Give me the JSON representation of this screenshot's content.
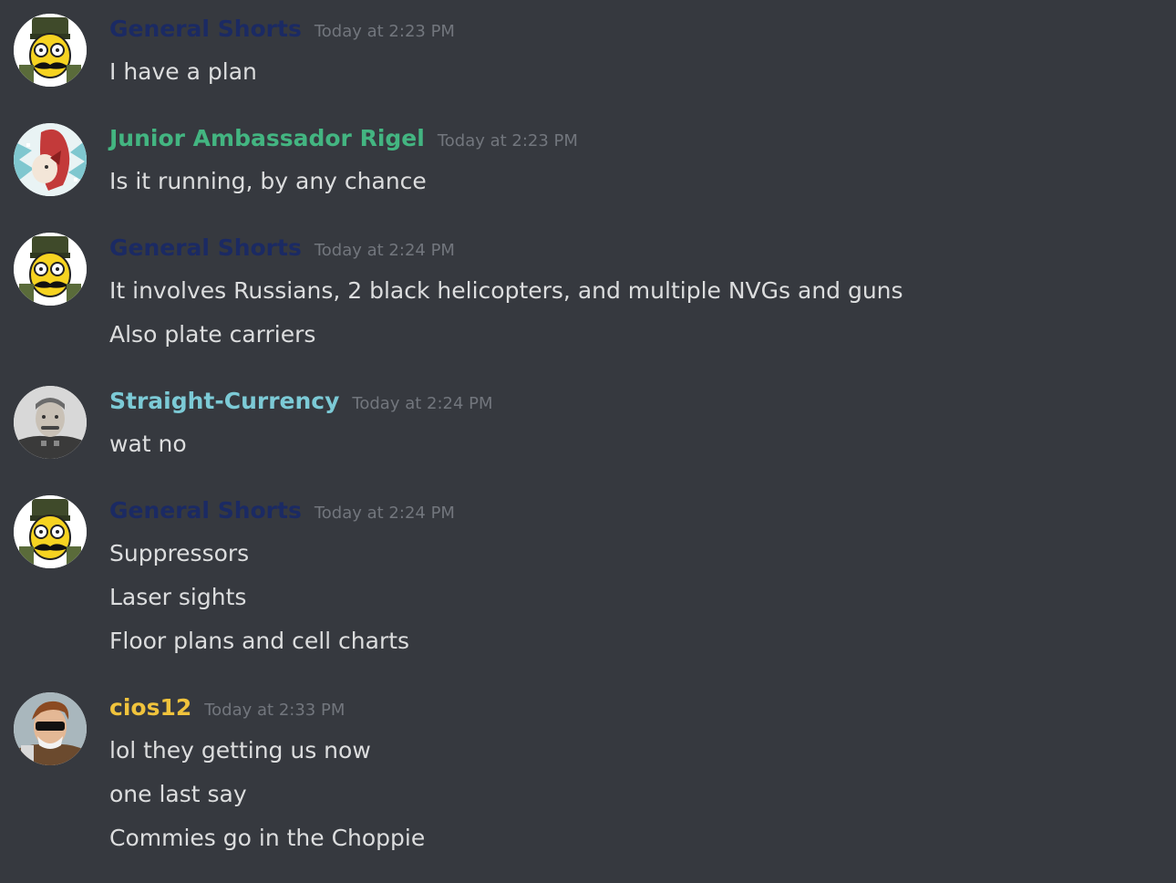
{
  "colors": {
    "background": "#36393f",
    "text": "#dcddde",
    "timestamp": "#72767d"
  },
  "messages": [
    {
      "author": "General Shorts",
      "author_color": "#1b2a63",
      "avatar_icon": "cartoon-general-avatar-icon",
      "timestamp": "Today at 2:23 PM",
      "lines": [
        "I have a plan"
      ]
    },
    {
      "author": "Junior Ambassador Rigel",
      "author_color": "#43b581",
      "avatar_icon": "anime-character-avatar-icon",
      "timestamp": "Today at 2:23 PM",
      "lines": [
        "Is it running, by any chance"
      ]
    },
    {
      "author": "General Shorts",
      "author_color": "#1b2a63",
      "avatar_icon": "cartoon-general-avatar-icon",
      "timestamp": "Today at 2:24 PM",
      "lines": [
        "It involves Russians, 2 black helicopters, and multiple NVGs and guns",
        "Also plate carriers"
      ]
    },
    {
      "author": "Straight-Currency",
      "author_color": "#7ccad6",
      "avatar_icon": "portrait-photo-avatar-icon",
      "timestamp": "Today at 2:24 PM",
      "lines": [
        "wat no"
      ]
    },
    {
      "author": "General Shorts",
      "author_color": "#1b2a63",
      "avatar_icon": "cartoon-general-avatar-icon",
      "timestamp": "Today at 2:24 PM",
      "lines": [
        "Suppressors",
        "Laser sights",
        "Floor plans and cell charts"
      ]
    },
    {
      "author": "cios12",
      "author_color": "#f0c33c",
      "avatar_icon": "sunglasses-man-avatar-icon",
      "timestamp": "Today at 2:33 PM",
      "lines": [
        "lol they getting us now",
        "one last say",
        "Commies go in the Choppie"
      ]
    }
  ]
}
